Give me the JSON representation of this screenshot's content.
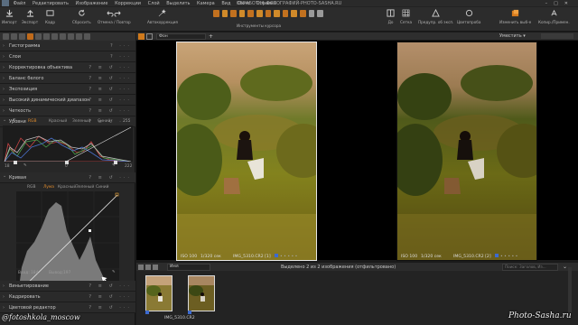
{
  "menubar": {
    "items": [
      "Файл",
      "Редактировать",
      "Изображение",
      "Коррекции",
      "Слой",
      "Выделить",
      "Камера",
      "Вид",
      "Окно",
      "Справка"
    ],
    "title": "ОБРАБОТКА-ФОТОГРАФИЙ-PHOTO-SASHA.RU"
  },
  "toolbar": {
    "import": "Импорт",
    "export": "Экспорт",
    "process": "Кадр",
    "reset": "Сбросить",
    "undo_redo": "Отмена / Повтор",
    "autocorrect": "Автокоррекция",
    "cursor_tools": "Инструменты курсора",
    "before": "До",
    "grid": "Сетка",
    "exposure_warn": "Предупр. об эксп.",
    "proof": "Цветопроба",
    "change_selection": "Изменить выб-е",
    "copy_apply": "Копир./Примен."
  },
  "panel": {
    "tools": {
      "histogram": "Гистограмма",
      "layers": "Слои",
      "lens": "Корректировка объектива",
      "white_balance": "Баланс белого",
      "exposure": "Экспозиция",
      "hdr": "Высокий динамический диапазон",
      "clarity": "Четкость",
      "levels": "Уровни",
      "curve": "Кривая",
      "vignetting": "Виньетирование",
      "crop": "Кадрировать",
      "color_editor": "Цветовой редактор"
    },
    "levels": {
      "tabs": [
        "RGB",
        "Красный",
        "Зеленый",
        "Синий"
      ],
      "max_value": "255",
      "low": "18",
      "mid": "0",
      "high": "222"
    },
    "curve": {
      "tabs": [
        "RGB",
        "Лума",
        "Красный",
        "Зеленый",
        "Синий"
      ],
      "input_label": "Ввод:",
      "input_value": "184",
      "output_label": "Вывод:",
      "output_value": "197"
    }
  },
  "viewer": {
    "layer": "Фон",
    "fit": "Уместить",
    "left": {
      "iso": "ISO 100",
      "shutter": "1/320 сек",
      "name": "IMG_5310.CR2 [1]"
    },
    "right": {
      "iso": "ISO 100",
      "shutter": "1/320 сек",
      "name": "IMG_5310.CR2 [2]"
    }
  },
  "browser": {
    "sort": "Имя",
    "status": "Выделено 2 из 2 изображения (отфильтровано)",
    "search_placeholder": "Поиск: Заголов, Из...",
    "filename": "IMG_5310.CR2"
  },
  "watermarks": {
    "left": "@fotoshkola_moscow",
    "right": "Photo-Sasha.ru"
  },
  "colors": {
    "accent": "#e08a2a",
    "panel": "#272727",
    "selected_thumb": "#d8d8d8"
  }
}
